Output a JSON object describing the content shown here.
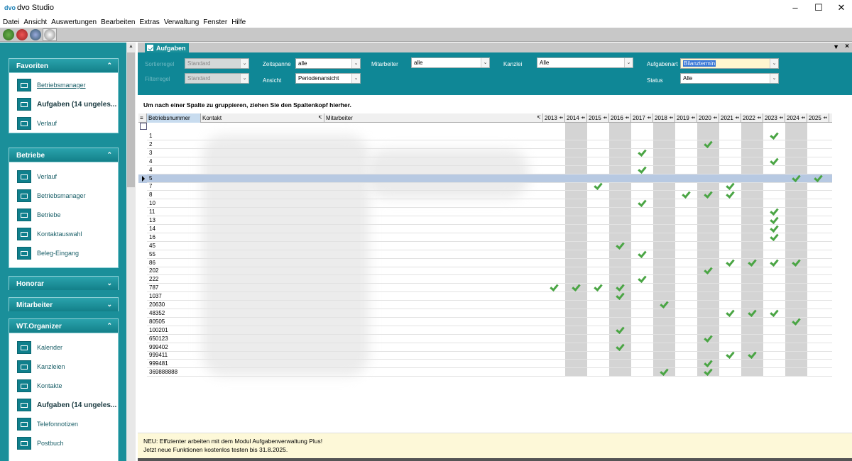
{
  "window": {
    "title": "dvo Studio"
  },
  "menu": [
    "Datei",
    "Ansicht",
    "Auswertungen",
    "Bearbeiten",
    "Extras",
    "Verwaltung",
    "Fenster",
    "Hilfe"
  ],
  "sidebar": {
    "groups": [
      {
        "title": "Favoriten",
        "items": [
          {
            "label": "Betriebsmanager",
            "icon": "building-icon"
          },
          {
            "label": "Aufgaben (14 ungeles...",
            "icon": "tasks-icon"
          },
          {
            "label": "Verlauf",
            "icon": "history-icon"
          }
        ]
      },
      {
        "title": "Betriebe",
        "items": [
          {
            "label": "Verlauf",
            "icon": "history-icon"
          },
          {
            "label": "Betriebsmanager",
            "icon": "building-icon"
          },
          {
            "label": "Betriebe",
            "icon": "buildings-icon"
          },
          {
            "label": "Kontaktauswahl",
            "icon": "contact-select-icon"
          },
          {
            "label": "Beleg-Eingang",
            "icon": "receipt-icon"
          }
        ]
      },
      {
        "title": "Honorar",
        "items": []
      },
      {
        "title": "Mitarbeiter",
        "items": []
      },
      {
        "title": "WT.Organizer",
        "items": [
          {
            "label": "Kalender",
            "icon": "calendar-icon"
          },
          {
            "label": "Kanzleien",
            "icon": "office-icon"
          },
          {
            "label": "Kontakte",
            "icon": "contacts-icon"
          },
          {
            "label": "Aufgaben (14 ungeles...",
            "icon": "tasks-icon"
          },
          {
            "label": "Telefonnotizen",
            "icon": "phone-icon"
          },
          {
            "label": "Postbuch",
            "icon": "mail-icon"
          }
        ]
      }
    ]
  },
  "tab": {
    "label": "Aufgaben"
  },
  "filters": {
    "sortierregel_label": "Sortierregel",
    "sortierregel_value": "Standard",
    "filterregel_label": "Filterregel",
    "filterregel_value": "Standard",
    "zeitspanne_label": "Zeitspanne",
    "zeitspanne_value": "alle",
    "ansicht_label": "Ansicht",
    "ansicht_value": "Periodenansicht",
    "mitarbeiter_label": "Mitarbeiter",
    "mitarbeiter_value": "alle",
    "kanzlei_label": "Kanzlei",
    "kanzlei_value": "Alle",
    "aufgabenart_label": "Aufgabenart",
    "aufgabenart_value": "Bilanztermin",
    "status_label": "Status",
    "status_value": "Alle"
  },
  "group_hint": "Um nach einer Spalte zu gruppieren, ziehen Sie den Spaltenkopf hierher.",
  "grid": {
    "columns": {
      "betriebsnummer": "Betriebsnummer",
      "kontakt": "Kontakt",
      "mitarbeiter": "Mitarbeiter"
    },
    "years": [
      "2013",
      "2014",
      "2015",
      "2016",
      "2017",
      "2018",
      "2019",
      "2020",
      "2021",
      "2022",
      "2023",
      "2024",
      "2025"
    ],
    "rows": [
      {
        "nr": "1",
        "checks": [
          "2023"
        ]
      },
      {
        "nr": "2",
        "checks": [
          "2020"
        ]
      },
      {
        "nr": "3",
        "checks": [
          "2017"
        ]
      },
      {
        "nr": "4",
        "checks": [
          "2023"
        ]
      },
      {
        "nr": "4",
        "checks": [
          "2017"
        ]
      },
      {
        "nr": "5",
        "checks": [
          "2024",
          "2025"
        ],
        "active": true
      },
      {
        "nr": "7",
        "checks": [
          "2015",
          "2021"
        ]
      },
      {
        "nr": "8",
        "checks": [
          "2019",
          "2020",
          "2021"
        ]
      },
      {
        "nr": "10",
        "checks": [
          "2017"
        ]
      },
      {
        "nr": "11",
        "checks": [
          "2023"
        ]
      },
      {
        "nr": "13",
        "checks": [
          "2023"
        ]
      },
      {
        "nr": "14",
        "checks": [
          "2023"
        ]
      },
      {
        "nr": "16",
        "checks": [
          "2023"
        ]
      },
      {
        "nr": "45",
        "checks": [
          "2016"
        ]
      },
      {
        "nr": "55",
        "checks": [
          "2017"
        ]
      },
      {
        "nr": "86",
        "checks": [
          "2021",
          "2022",
          "2023",
          "2024"
        ]
      },
      {
        "nr": "202",
        "checks": [
          "2020"
        ]
      },
      {
        "nr": "222",
        "checks": [
          "2017"
        ]
      },
      {
        "nr": "787",
        "checks": [
          "2013",
          "2014",
          "2015",
          "2016"
        ]
      },
      {
        "nr": "1037",
        "checks": [
          "2016"
        ]
      },
      {
        "nr": "20630",
        "checks": [
          "2018"
        ]
      },
      {
        "nr": "48352",
        "checks": [
          "2021",
          "2022",
          "2023"
        ]
      },
      {
        "nr": "80505",
        "checks": [
          "2024"
        ]
      },
      {
        "nr": "100201",
        "checks": [
          "2016"
        ]
      },
      {
        "nr": "650123",
        "checks": [
          "2020"
        ]
      },
      {
        "nr": "999402",
        "checks": [
          "2016"
        ]
      },
      {
        "nr": "999411",
        "checks": [
          "2021",
          "2022"
        ]
      },
      {
        "nr": "999481",
        "checks": [
          "2020"
        ]
      },
      {
        "nr": "369888888",
        "checks": [
          "2018",
          "2020"
        ]
      }
    ]
  },
  "notice": {
    "line1": "NEU: Effizienter arbeiten mit dem Modul Aufgabenverwaltung Plus!",
    "line2": "Jetzt neue Funktionen kostenlos testen bis 31.8.2025."
  }
}
